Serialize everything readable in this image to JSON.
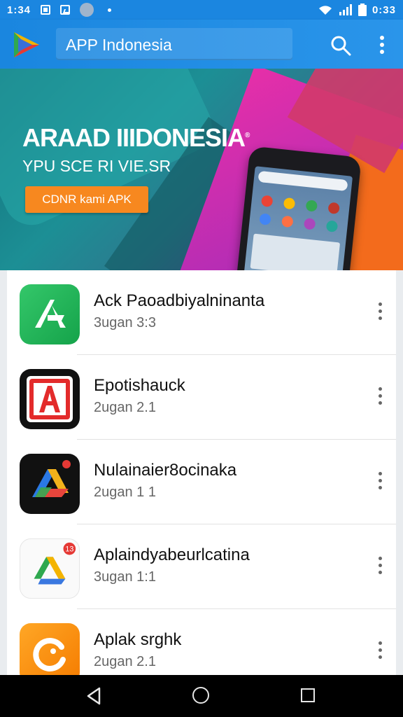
{
  "status_bar": {
    "time": "1:34",
    "clock": "0:33"
  },
  "app_bar": {
    "title": "APP Indonesia"
  },
  "banner": {
    "title": "ARAAD IIIDONESIA",
    "trademark": "®",
    "subtitle": "YPU SCE RI VIE.SR",
    "button_label": "CDNR kami APK"
  },
  "apps": [
    {
      "name": "Ack Paoadbiyalninanta",
      "meta": "3ugan 3:3"
    },
    {
      "name": "Epotishauck",
      "meta": "2ugan 2.1"
    },
    {
      "name": "Nulainaier8ocinaka",
      "meta": "2ugan 1 1"
    },
    {
      "name": "Aplaindyabeurlcatina",
      "meta": "3ugan 1:1"
    },
    {
      "name": "Aplak srghk",
      "meta": "2ugan 2.1"
    }
  ],
  "colors": {
    "primary": "#1b86e0",
    "accent": "#f7881f"
  }
}
